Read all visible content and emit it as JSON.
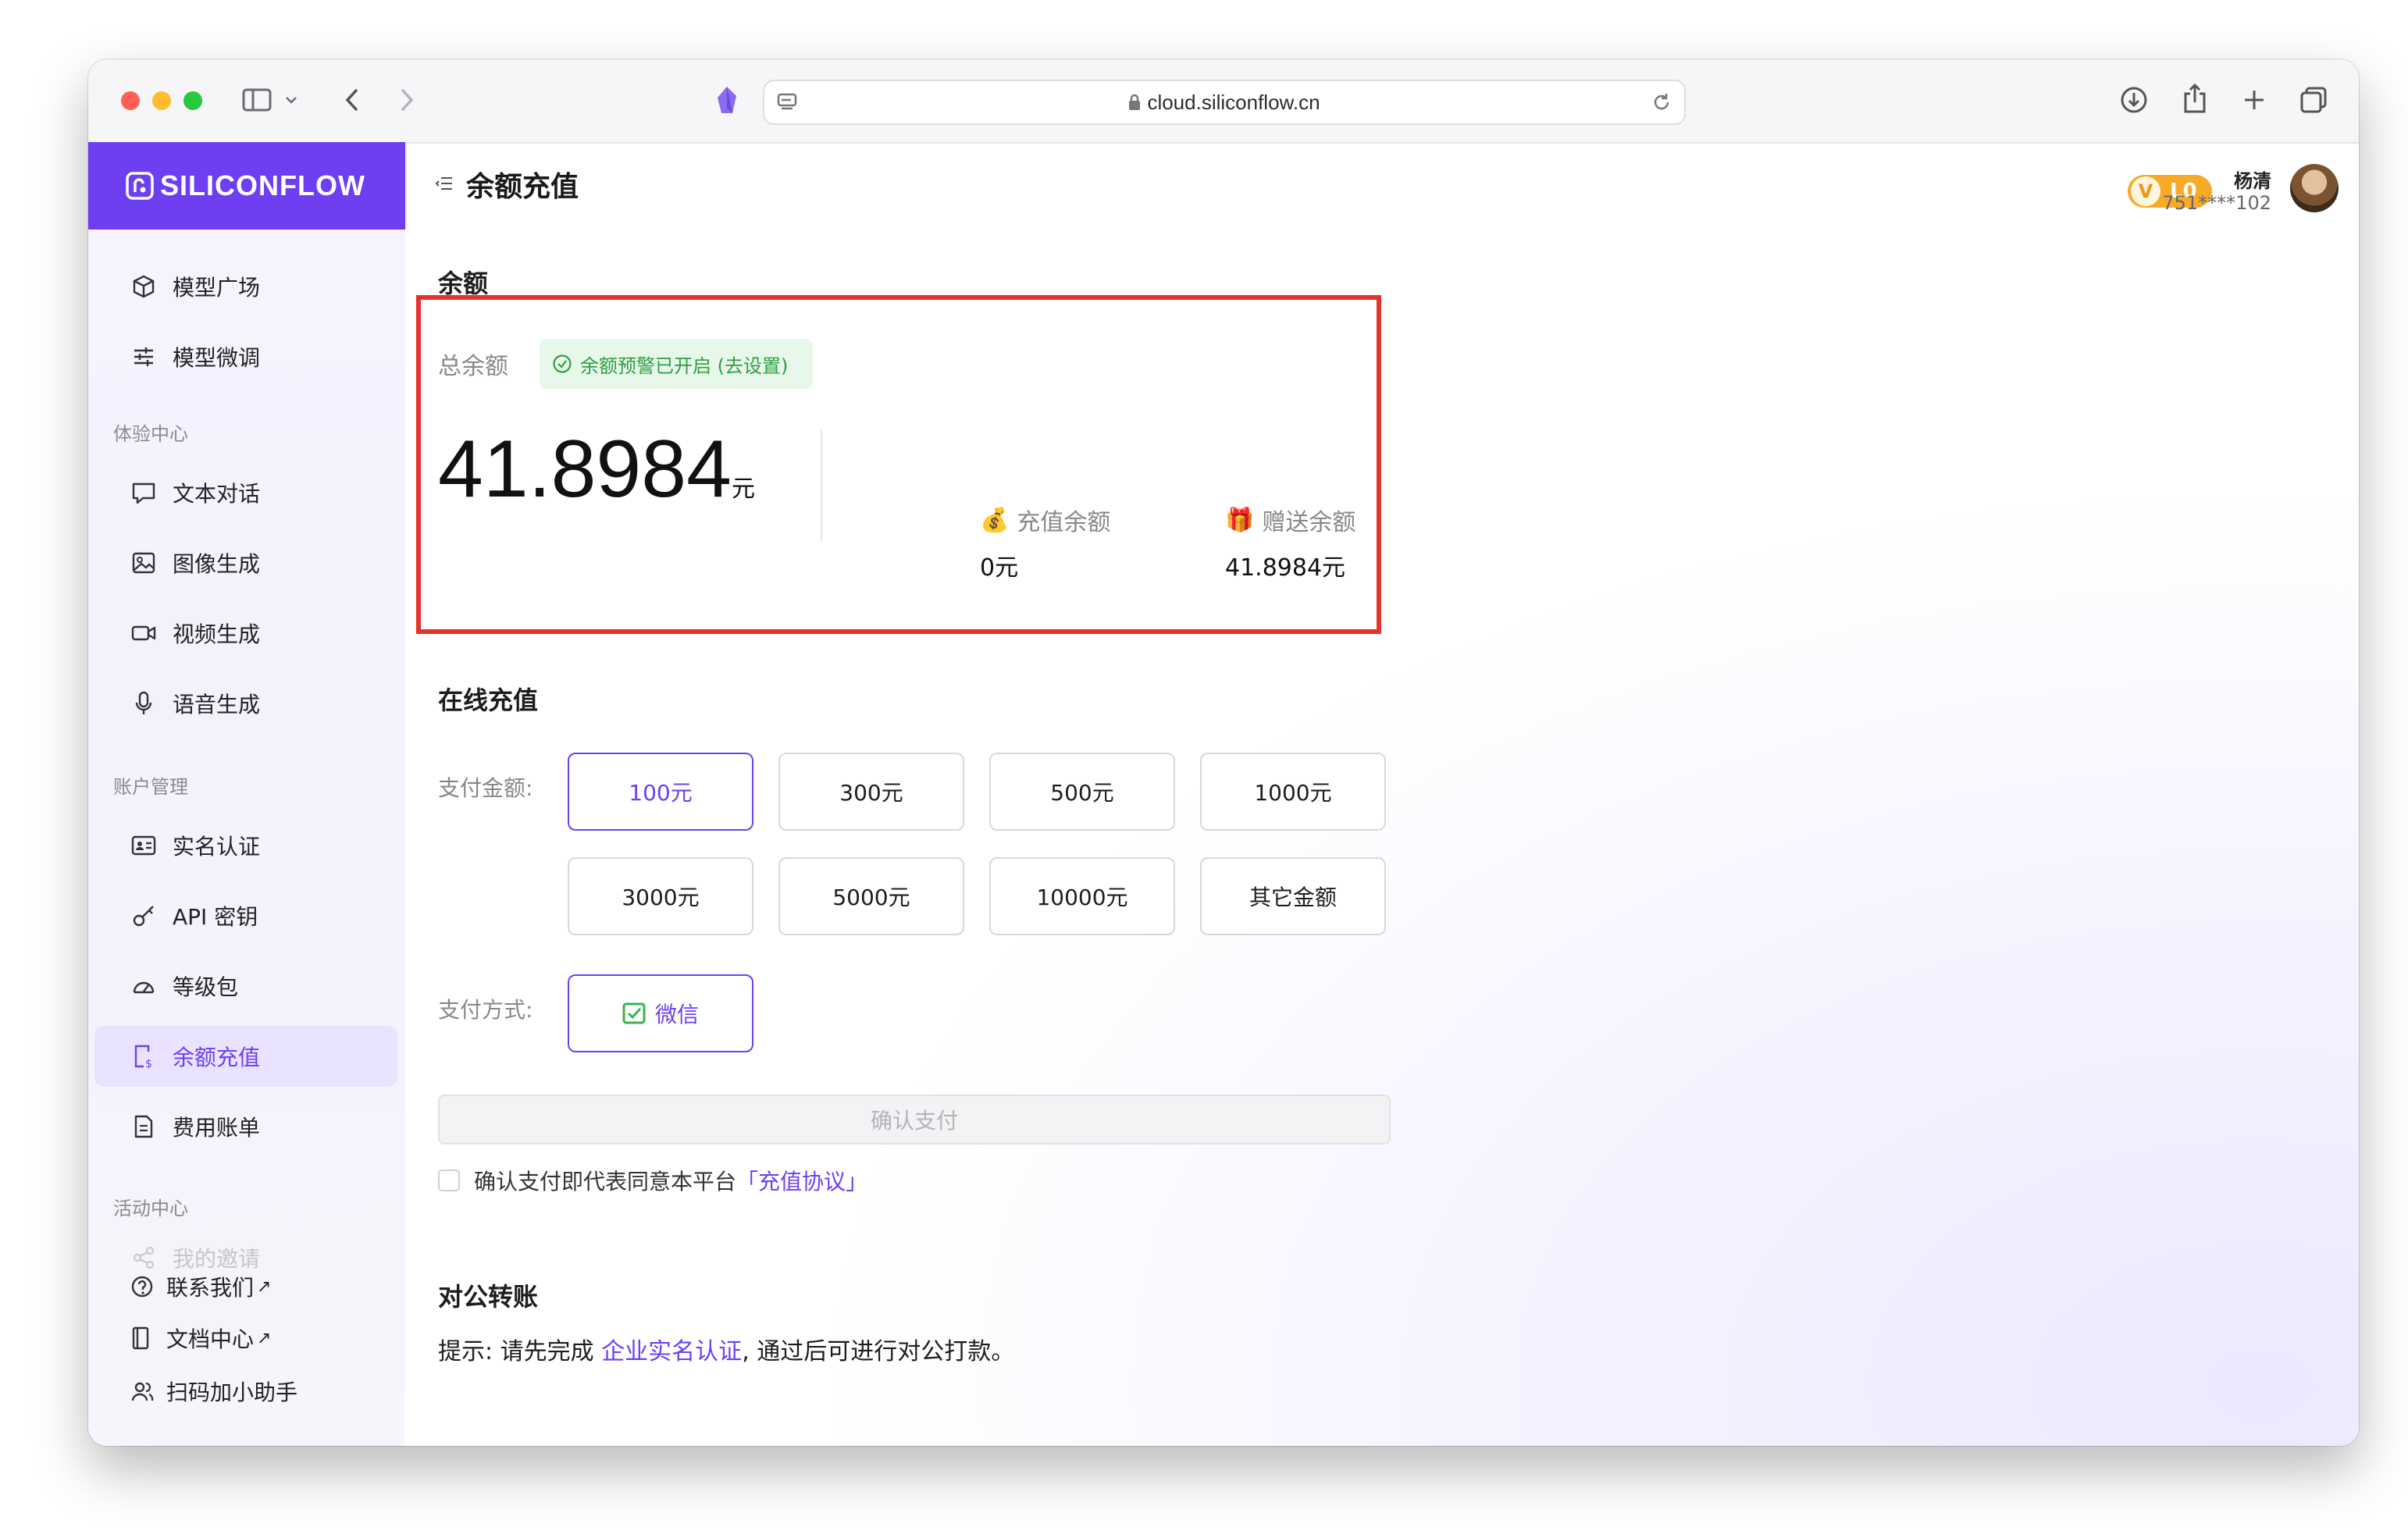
{
  "browser": {
    "url": "cloud.siliconflow.cn"
  },
  "brand": {
    "name": "SILICONFLOW",
    "accent": "#6e3ff0"
  },
  "sidebar": {
    "top_items": [
      {
        "label": "模型广场",
        "icon": "cube-icon"
      },
      {
        "label": "模型微调",
        "icon": "sliders-icon"
      }
    ],
    "sections": [
      {
        "title": "体验中心",
        "items": [
          {
            "label": "文本对话",
            "icon": "chat-icon"
          },
          {
            "label": "图像生成",
            "icon": "image-icon"
          },
          {
            "label": "视频生成",
            "icon": "video-icon"
          },
          {
            "label": "语音生成",
            "icon": "mic-icon"
          }
        ]
      },
      {
        "title": "账户管理",
        "items": [
          {
            "label": "实名认证",
            "icon": "id-card-icon"
          },
          {
            "label": "API 密钥",
            "icon": "key-icon"
          },
          {
            "label": "等级包",
            "icon": "gauge-icon"
          },
          {
            "label": "余额充值",
            "icon": "recharge-icon",
            "active": true
          },
          {
            "label": "费用账单",
            "icon": "bill-icon"
          }
        ]
      },
      {
        "title": "活动中心",
        "items": [
          {
            "label": "我的邀请",
            "icon": "share-icon",
            "faded": true
          }
        ]
      }
    ],
    "footer": [
      {
        "label": "联系我们",
        "icon": "help-circle-icon",
        "external": "↗"
      },
      {
        "label": "文档中心",
        "icon": "book-icon",
        "external": "↗"
      },
      {
        "label": "扫码加小助手",
        "icon": "users-icon"
      }
    ]
  },
  "header": {
    "title": "余额充值",
    "level": {
      "v": "V",
      "label": "L0"
    },
    "user": {
      "name": "杨清",
      "phone": "751****102"
    }
  },
  "balance": {
    "section_title": "余额",
    "total_label": "总余额",
    "alert_text": "余额预警已开启 (去设置)",
    "total_value": "41.8984",
    "unit": "元",
    "recharge": {
      "emoji": "💰",
      "label": "充值余额",
      "value": "0元"
    },
    "gift": {
      "emoji": "🎁",
      "label": "赠送余额",
      "value": "41.8984元"
    }
  },
  "online": {
    "section_title": "在线充值",
    "amount_label": "支付金额:",
    "amounts": [
      "100元",
      "300元",
      "500元",
      "1000元",
      "3000元",
      "5000元",
      "10000元",
      "其它金额"
    ],
    "selected_amount_index": 0,
    "method_label": "支付方式:",
    "method": "微信",
    "confirm_label": "确认支付",
    "agree_text": "确认支付即代表同意本平台",
    "agree_link": "「充值协议」"
  },
  "corporate": {
    "section_title": "对公转账",
    "tip_prefix": "提示: 请先完成 ",
    "tip_link": "企业实名认证",
    "tip_suffix": ", 通过后可进行对公打款。"
  }
}
